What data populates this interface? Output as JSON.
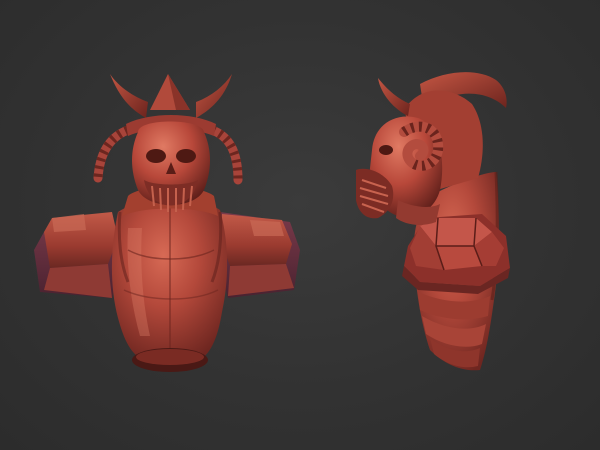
{
  "scene": {
    "background_color": "#303030",
    "material_color": "#b44a3c",
    "views": [
      {
        "name": "front",
        "subject": "horned-helmet-armor-bust"
      },
      {
        "name": "side",
        "subject": "horned-helmet-armor-bust"
      }
    ]
  }
}
